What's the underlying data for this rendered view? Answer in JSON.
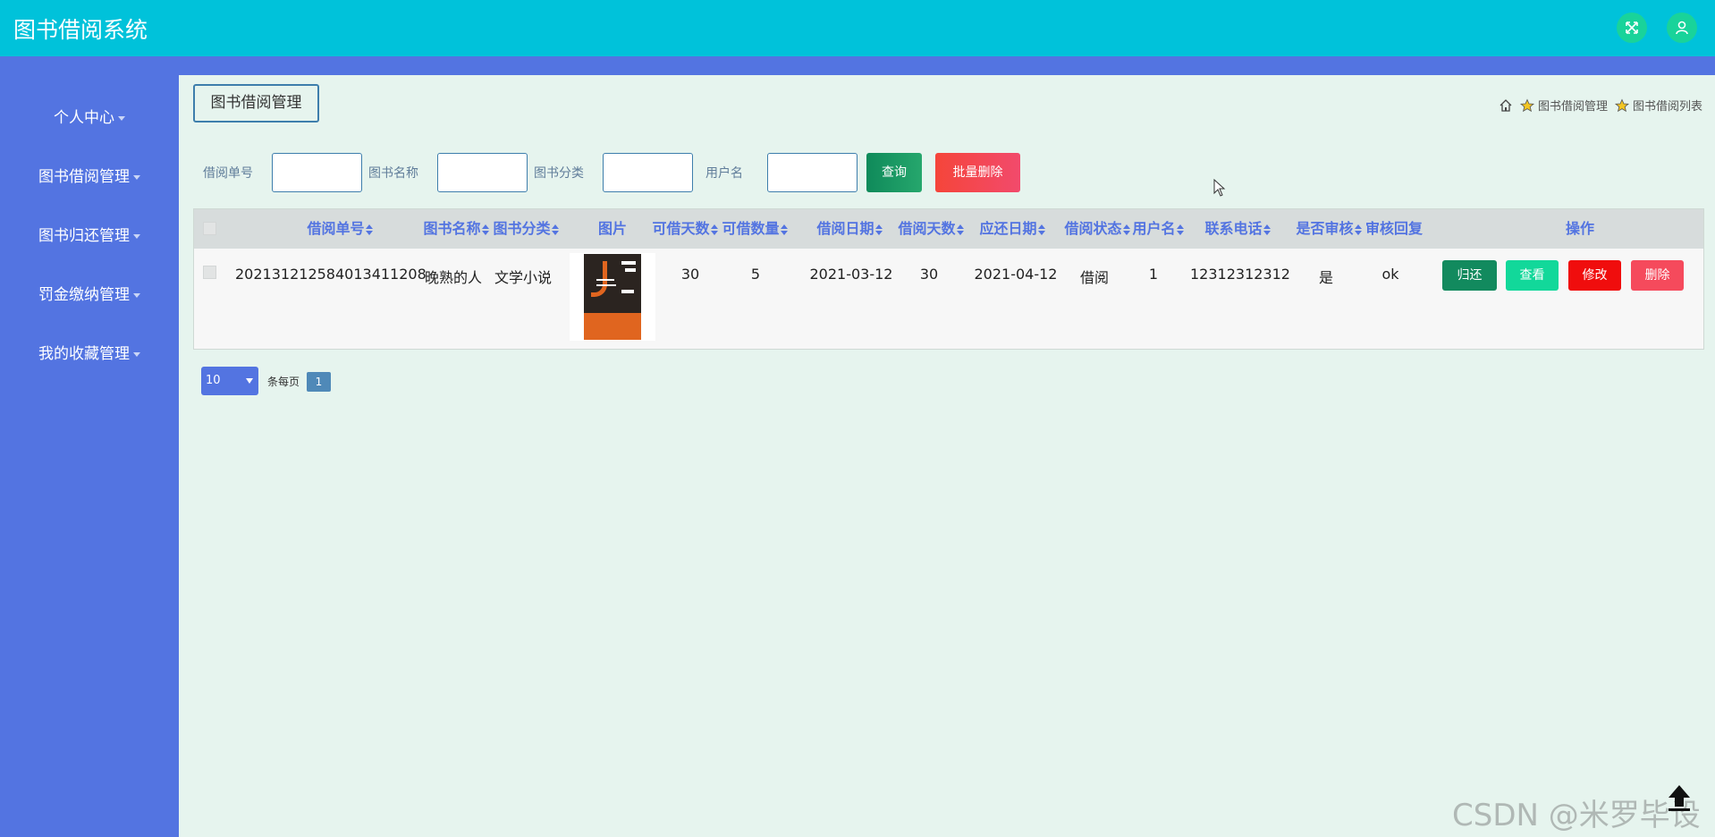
{
  "header": {
    "app_title": "图书借阅系统",
    "icons": [
      "fullscreen-icon",
      "user-icon"
    ],
    "color": "#00c2da"
  },
  "sidebar": {
    "color": "#5374e1",
    "items": [
      {
        "label": "个人中心"
      },
      {
        "label": "图书借阅管理"
      },
      {
        "label": "图书归还管理"
      },
      {
        "label": "罚金缴纳管理"
      },
      {
        "label": "我的收藏管理"
      }
    ]
  },
  "main": {
    "page_title": "图书借阅管理",
    "breadcrumb": [
      "图书借阅管理",
      "图书借阅列表"
    ]
  },
  "search": {
    "fields": [
      {
        "label": "借阅单号",
        "value": ""
      },
      {
        "label": "图书名称",
        "value": ""
      },
      {
        "label": "图书分类",
        "value": ""
      },
      {
        "label": "用户名",
        "value": ""
      }
    ],
    "query_label": "查询",
    "batch_delete_label": "批量删除"
  },
  "table": {
    "columns": [
      "借阅单号",
      "图书名称",
      "图书分类",
      "图片",
      "可借天数",
      "可借数量",
      "借阅日期",
      "借阅天数",
      "应还日期",
      "借阅状态",
      "用户名",
      "联系电话",
      "是否审核",
      "审核回复",
      "操作"
    ],
    "rows": [
      {
        "borrow_no": "20213121258401341120​8",
        "book_name": "晚熟的人",
        "category": "文学小说",
        "image": "book-cover-image",
        "loan_days": "30",
        "quantity": "5",
        "borrow_date": "2021-03-12",
        "borrow_days": "30",
        "due_date": "2021-04-12",
        "status": "借阅",
        "username": "1",
        "phone": "12312312312",
        "audited": "是",
        "audit_reply": "ok",
        "actions": [
          "归还",
          "查看",
          "修改",
          "删除"
        ]
      }
    ]
  },
  "pagination": {
    "page_size": "10",
    "per_page_label": "条每页",
    "current_page": "1"
  },
  "watermark": "CSDN @米罗毕设"
}
